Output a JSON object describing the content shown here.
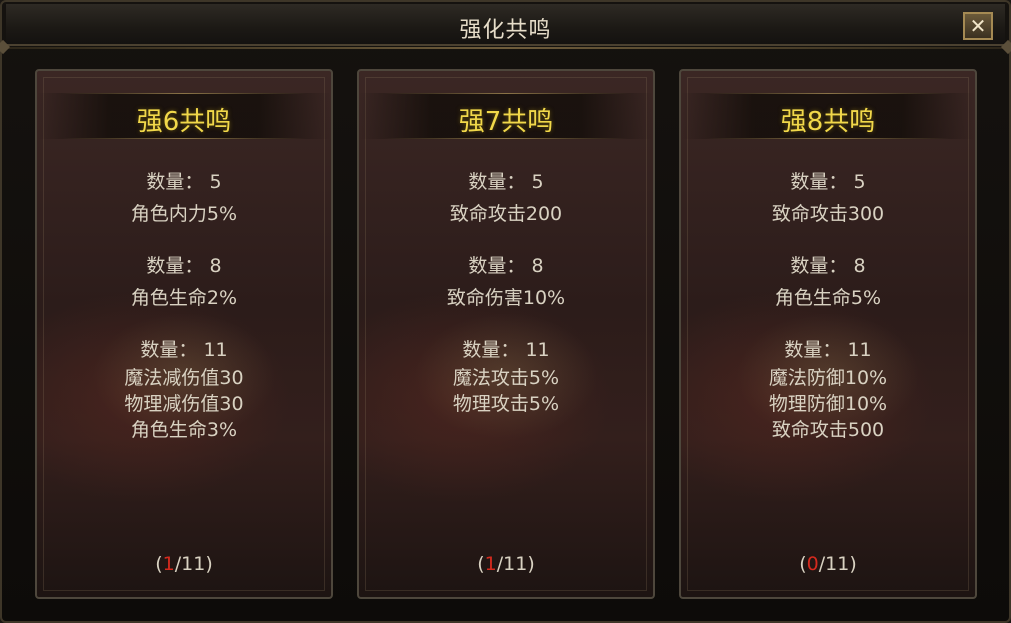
{
  "window": {
    "title": "强化共鸣"
  },
  "close_button": {
    "label": "✕"
  },
  "panels": [
    {
      "title": "强6共鸣",
      "groups": [
        {
          "count_label": "数量：",
          "count": "5",
          "effects": [
            "角色内力5%"
          ]
        },
        {
          "count_label": "数量：",
          "count": "8",
          "effects": [
            "角色生命2%"
          ]
        },
        {
          "count_label": "数量：",
          "count": "11",
          "effects": [
            "魔法减伤值30",
            "物理减伤值30",
            "角色生命3%"
          ]
        }
      ],
      "progress": {
        "open": "(",
        "current": "1",
        "sep_total": "/11)"
      }
    },
    {
      "title": "强7共鸣",
      "groups": [
        {
          "count_label": "数量：",
          "count": "5",
          "effects": [
            "致命攻击200"
          ]
        },
        {
          "count_label": "数量：",
          "count": "8",
          "effects": [
            "致命伤害10%"
          ]
        },
        {
          "count_label": "数量：",
          "count": "11",
          "effects": [
            "魔法攻击5%",
            "物理攻击5%"
          ]
        }
      ],
      "progress": {
        "open": "(",
        "current": "1",
        "sep_total": "/11)"
      }
    },
    {
      "title": "强8共鸣",
      "groups": [
        {
          "count_label": "数量：",
          "count": "5",
          "effects": [
            "致命攻击300"
          ]
        },
        {
          "count_label": "数量：",
          "count": "8",
          "effects": [
            "角色生命5%"
          ]
        },
        {
          "count_label": "数量：",
          "count": "11",
          "effects": [
            "魔法防御10%",
            "物理防御10%",
            "致命攻击500"
          ]
        }
      ],
      "progress": {
        "open": "(",
        "current": "0",
        "sep_total": "/11)"
      }
    }
  ],
  "colors": {
    "title_gold": "#f1d84a",
    "body_text": "#d9d2c2",
    "progress_current": "#d42a1e"
  }
}
